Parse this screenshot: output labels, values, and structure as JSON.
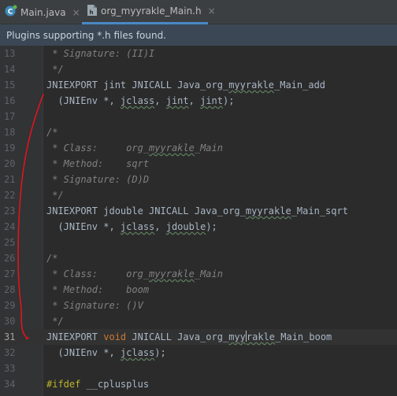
{
  "tabs": [
    {
      "label": "Main.java",
      "close": "×"
    },
    {
      "label": "org_myyrakle_Main.h",
      "close": "×"
    }
  ],
  "banner": {
    "text": "Plugins supporting *.h files found."
  },
  "editor": {
    "current_line": "31",
    "lines": [
      {
        "num": "13",
        "parts": [
          {
            "t": " * Signature: (II)I",
            "c": "comment"
          }
        ]
      },
      {
        "num": "14",
        "parts": [
          {
            "t": " */",
            "c": "comment"
          }
        ]
      },
      {
        "num": "15",
        "parts": [
          {
            "t": "JNIEXPORT ",
            "c": "plain"
          },
          {
            "t": "jint",
            "c": "plain"
          },
          {
            "t": " JNICALL Java_org_",
            "c": "plain"
          },
          {
            "t": "myyrakle",
            "c": "under"
          },
          {
            "t": "_Main_add",
            "c": "plain"
          }
        ]
      },
      {
        "num": "16",
        "parts": [
          {
            "t": "  (JNIEnv *, ",
            "c": "plain"
          },
          {
            "t": "jclass",
            "c": "under"
          },
          {
            "t": ", ",
            "c": "plain"
          },
          {
            "t": "jint",
            "c": "under"
          },
          {
            "t": ", ",
            "c": "plain"
          },
          {
            "t": "jint",
            "c": "under"
          },
          {
            "t": ");",
            "c": "plain"
          }
        ]
      },
      {
        "num": "17",
        "parts": []
      },
      {
        "num": "18",
        "parts": [
          {
            "t": "/*",
            "c": "comment"
          }
        ]
      },
      {
        "num": "19",
        "parts": [
          {
            "t": " * Class:     org_",
            "c": "comment"
          },
          {
            "t": "myyrakle",
            "c": "comment-under"
          },
          {
            "t": "_Main",
            "c": "comment"
          }
        ]
      },
      {
        "num": "20",
        "parts": [
          {
            "t": " * Method:    sqrt",
            "c": "comment"
          }
        ]
      },
      {
        "num": "21",
        "parts": [
          {
            "t": " * Signature: (D)D",
            "c": "comment"
          }
        ]
      },
      {
        "num": "22",
        "parts": [
          {
            "t": " */",
            "c": "comment"
          }
        ]
      },
      {
        "num": "23",
        "parts": [
          {
            "t": "JNIEXPORT ",
            "c": "plain"
          },
          {
            "t": "jdouble",
            "c": "plain"
          },
          {
            "t": " JNICALL Java_org_",
            "c": "plain"
          },
          {
            "t": "myyrakle",
            "c": "under"
          },
          {
            "t": "_Main_sqrt",
            "c": "plain"
          }
        ]
      },
      {
        "num": "24",
        "parts": [
          {
            "t": "  (JNIEnv *, ",
            "c": "plain"
          },
          {
            "t": "jclass",
            "c": "under"
          },
          {
            "t": ", ",
            "c": "plain"
          },
          {
            "t": "jdouble",
            "c": "under"
          },
          {
            "t": ");",
            "c": "plain"
          }
        ]
      },
      {
        "num": "25",
        "parts": []
      },
      {
        "num": "26",
        "parts": [
          {
            "t": "/*",
            "c": "comment"
          }
        ]
      },
      {
        "num": "27",
        "parts": [
          {
            "t": " * Class:     org_",
            "c": "comment"
          },
          {
            "t": "myyrakle",
            "c": "comment-under"
          },
          {
            "t": "_Main",
            "c": "comment"
          }
        ]
      },
      {
        "num": "28",
        "parts": [
          {
            "t": " * Method:    boom",
            "c": "comment"
          }
        ]
      },
      {
        "num": "29",
        "parts": [
          {
            "t": " * Signature: ()V",
            "c": "comment"
          }
        ]
      },
      {
        "num": "30",
        "parts": [
          {
            "t": " */",
            "c": "comment"
          }
        ]
      },
      {
        "num": "31",
        "parts": [
          {
            "t": "JNIEXPORT ",
            "c": "plain"
          },
          {
            "t": "void",
            "c": "kw"
          },
          {
            "t": " JNICALL Java_org_",
            "c": "plain"
          },
          {
            "t": "myy",
            "c": "under"
          },
          {
            "t": "",
            "c": "caret"
          },
          {
            "t": "rakle",
            "c": "under"
          },
          {
            "t": "_Main_boom",
            "c": "plain"
          }
        ]
      },
      {
        "num": "32",
        "parts": [
          {
            "t": "  (JNIEnv *, ",
            "c": "plain"
          },
          {
            "t": "jclass",
            "c": "under"
          },
          {
            "t": ");",
            "c": "plain"
          }
        ]
      },
      {
        "num": "33",
        "parts": []
      },
      {
        "num": "34",
        "parts": [
          {
            "t": "#ifdef",
            "c": "macro"
          },
          {
            "t": " __cplusplus",
            "c": "plain"
          }
        ]
      }
    ]
  },
  "colors": {
    "accent": "#4a88c7",
    "banner_bg": "#3b4754",
    "scribble": "#e0141e"
  }
}
